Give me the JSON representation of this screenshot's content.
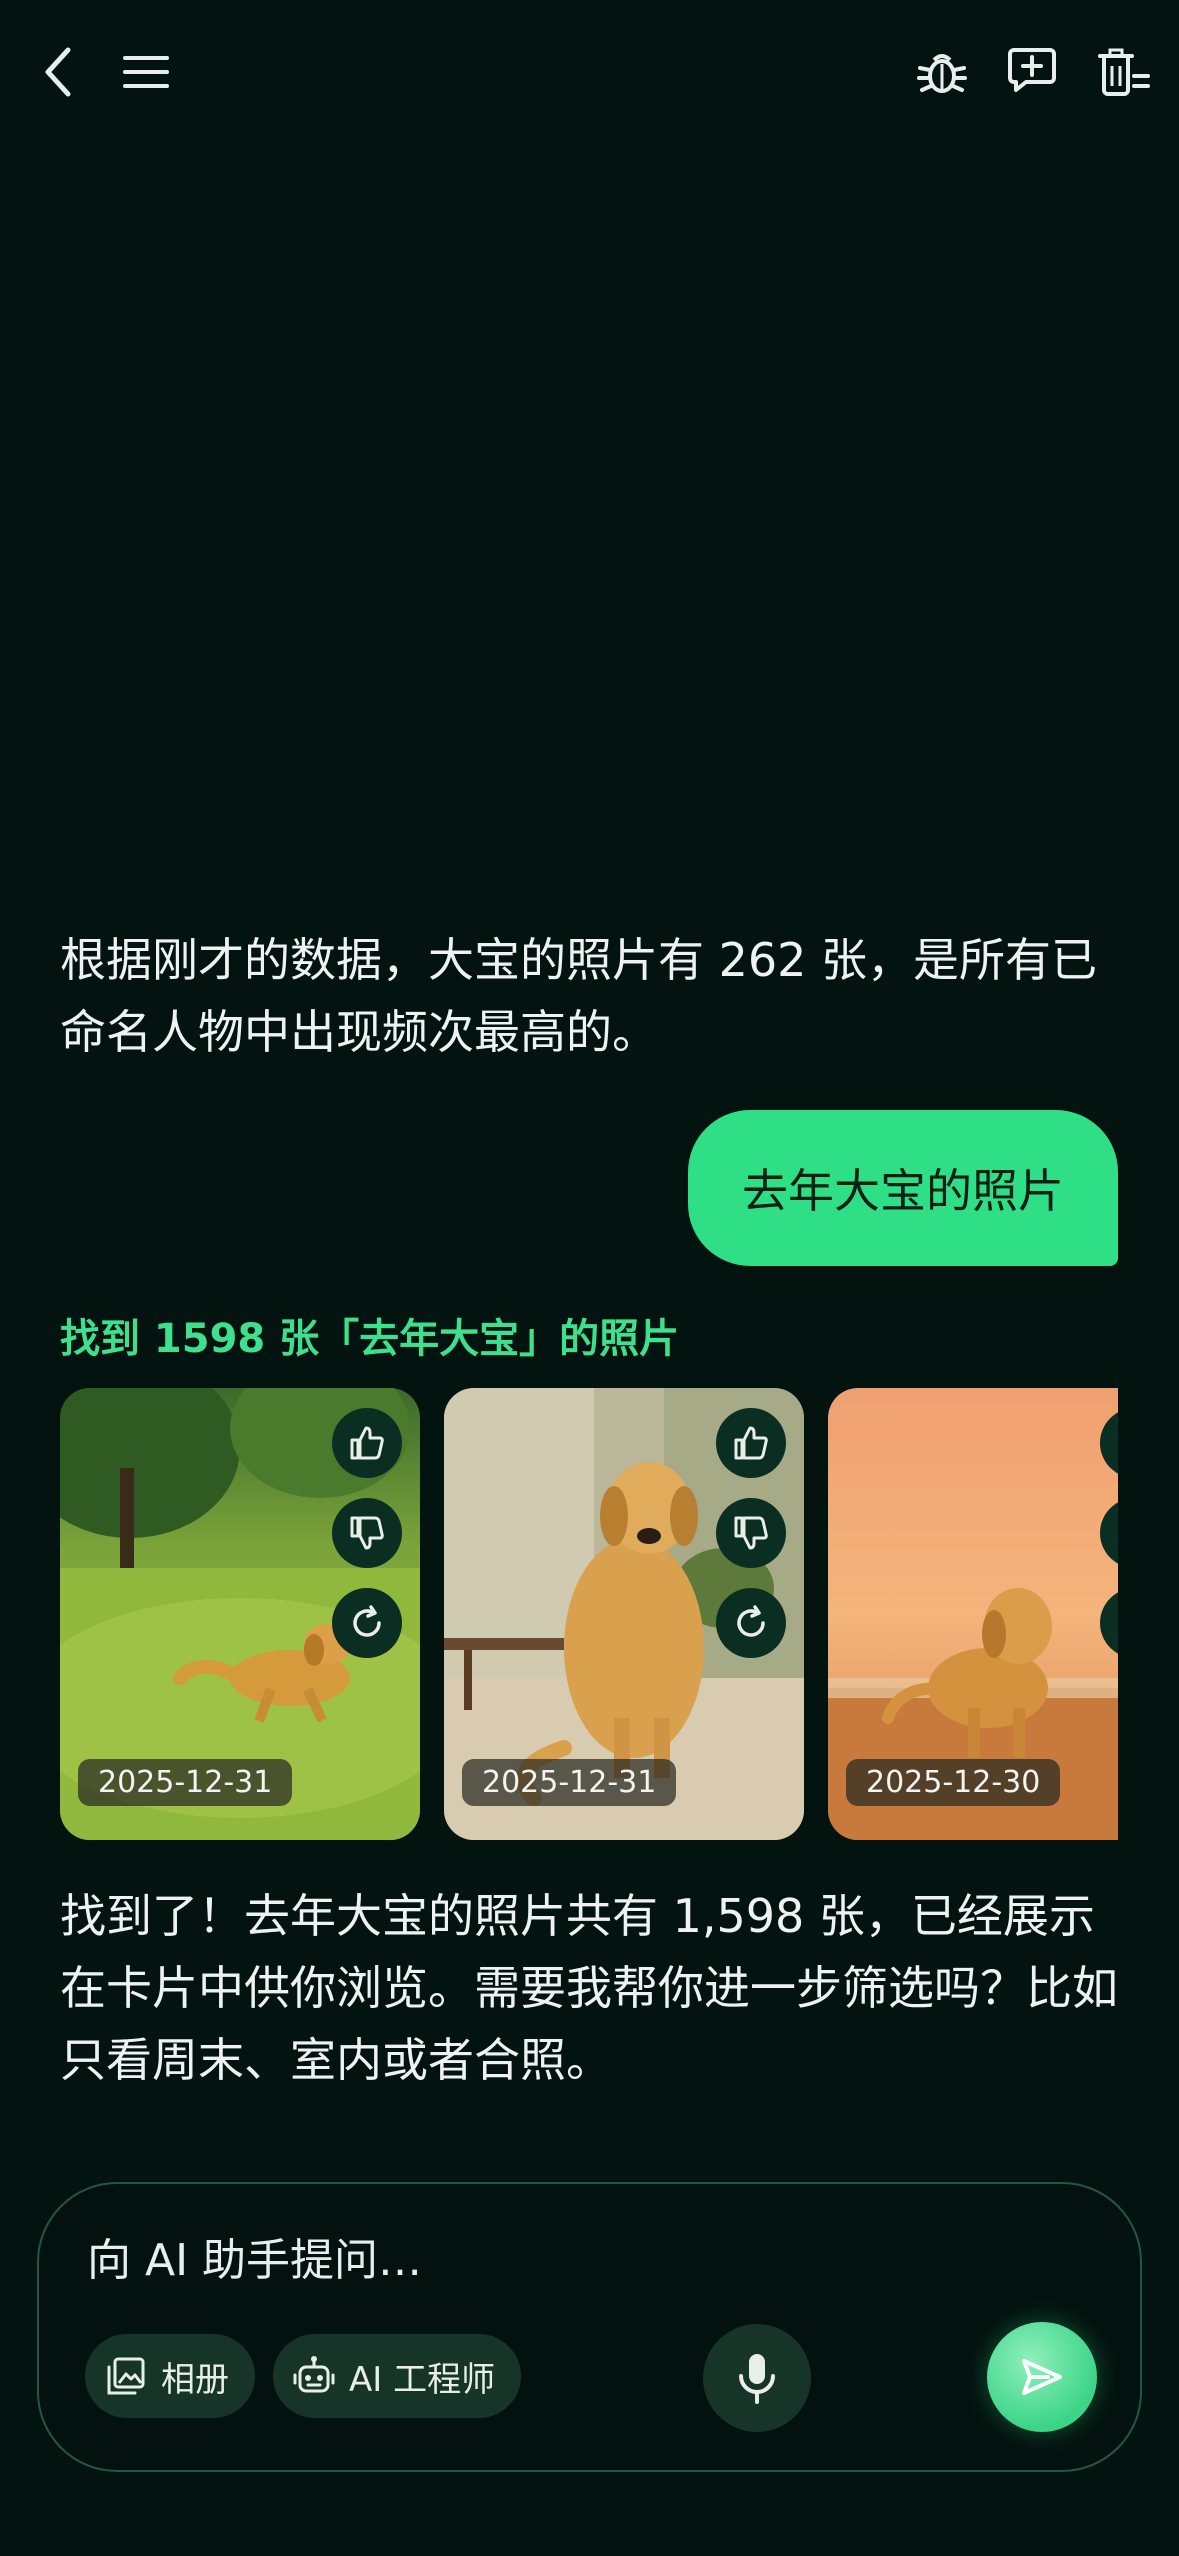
{
  "header": {
    "back_icon": "chevron-left-icon",
    "menu_icon": "hamburger-menu-icon",
    "debug_icon": "bug-icon",
    "new_chat_icon": "chat-plus-icon",
    "clear_icon": "trash-list-icon"
  },
  "messages": {
    "assistant_1": "根据刚才的数据，大宝的照片有 262 张，是所有已命名人物中出现频次最高的。",
    "user_1": "去年大宝的照片",
    "result_title": "找到 1598 张「去年大宝」的照片",
    "photos": [
      {
        "date": "2025-12-31",
        "subject": "golden retriever running on grass"
      },
      {
        "date": "2025-12-31",
        "subject": "golden retriever sitting on sofa"
      },
      {
        "date": "2025-12-30",
        "subject": "golden retriever on beach at sunset"
      }
    ],
    "assistant_2": "找到了！去年大宝的照片共有 1,598 张，已经展示在卡片中供你浏览。需要我帮你进一步筛选吗？比如只看周末、室内或者合照。"
  },
  "composer": {
    "placeholder": "向 AI 助手提问…",
    "chip_album": "相册",
    "chip_engineer": "AI 工程师"
  },
  "colors": {
    "background": "#031410",
    "accent": "#2fdf85",
    "title_green": "#3fe08d"
  }
}
